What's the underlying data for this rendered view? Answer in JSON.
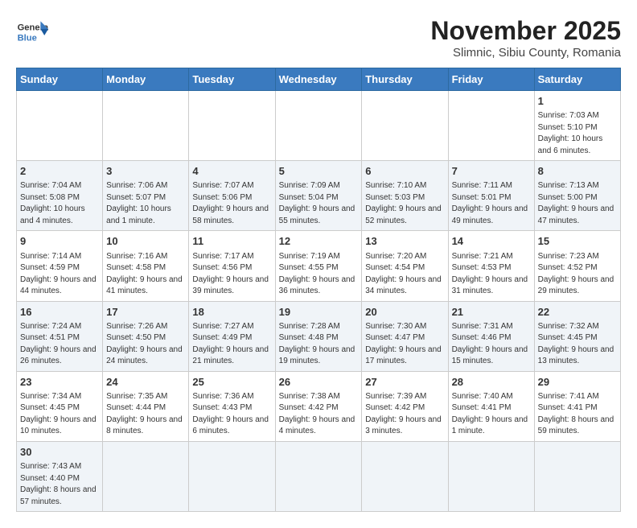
{
  "header": {
    "logo_text_line1": "General",
    "logo_text_line2": "Blue",
    "month_year": "November 2025",
    "location": "Slimnic, Sibiu County, Romania"
  },
  "days_of_week": [
    "Sunday",
    "Monday",
    "Tuesday",
    "Wednesday",
    "Thursday",
    "Friday",
    "Saturday"
  ],
  "weeks": [
    [
      {
        "day": "",
        "info": ""
      },
      {
        "day": "",
        "info": ""
      },
      {
        "day": "",
        "info": ""
      },
      {
        "day": "",
        "info": ""
      },
      {
        "day": "",
        "info": ""
      },
      {
        "day": "",
        "info": ""
      },
      {
        "day": "1",
        "info": "Sunrise: 7:03 AM\nSunset: 5:10 PM\nDaylight: 10 hours\nand 6 minutes."
      }
    ],
    [
      {
        "day": "2",
        "info": "Sunrise: 7:04 AM\nSunset: 5:08 PM\nDaylight: 10 hours\nand 4 minutes."
      },
      {
        "day": "3",
        "info": "Sunrise: 7:06 AM\nSunset: 5:07 PM\nDaylight: 10 hours\nand 1 minute."
      },
      {
        "day": "4",
        "info": "Sunrise: 7:07 AM\nSunset: 5:06 PM\nDaylight: 9 hours\nand 58 minutes."
      },
      {
        "day": "5",
        "info": "Sunrise: 7:09 AM\nSunset: 5:04 PM\nDaylight: 9 hours\nand 55 minutes."
      },
      {
        "day": "6",
        "info": "Sunrise: 7:10 AM\nSunset: 5:03 PM\nDaylight: 9 hours\nand 52 minutes."
      },
      {
        "day": "7",
        "info": "Sunrise: 7:11 AM\nSunset: 5:01 PM\nDaylight: 9 hours\nand 49 minutes."
      },
      {
        "day": "8",
        "info": "Sunrise: 7:13 AM\nSunset: 5:00 PM\nDaylight: 9 hours\nand 47 minutes."
      }
    ],
    [
      {
        "day": "9",
        "info": "Sunrise: 7:14 AM\nSunset: 4:59 PM\nDaylight: 9 hours\nand 44 minutes."
      },
      {
        "day": "10",
        "info": "Sunrise: 7:16 AM\nSunset: 4:58 PM\nDaylight: 9 hours\nand 41 minutes."
      },
      {
        "day": "11",
        "info": "Sunrise: 7:17 AM\nSunset: 4:56 PM\nDaylight: 9 hours\nand 39 minutes."
      },
      {
        "day": "12",
        "info": "Sunrise: 7:19 AM\nSunset: 4:55 PM\nDaylight: 9 hours\nand 36 minutes."
      },
      {
        "day": "13",
        "info": "Sunrise: 7:20 AM\nSunset: 4:54 PM\nDaylight: 9 hours\nand 34 minutes."
      },
      {
        "day": "14",
        "info": "Sunrise: 7:21 AM\nSunset: 4:53 PM\nDaylight: 9 hours\nand 31 minutes."
      },
      {
        "day": "15",
        "info": "Sunrise: 7:23 AM\nSunset: 4:52 PM\nDaylight: 9 hours\nand 29 minutes."
      }
    ],
    [
      {
        "day": "16",
        "info": "Sunrise: 7:24 AM\nSunset: 4:51 PM\nDaylight: 9 hours\nand 26 minutes."
      },
      {
        "day": "17",
        "info": "Sunrise: 7:26 AM\nSunset: 4:50 PM\nDaylight: 9 hours\nand 24 minutes."
      },
      {
        "day": "18",
        "info": "Sunrise: 7:27 AM\nSunset: 4:49 PM\nDaylight: 9 hours\nand 21 minutes."
      },
      {
        "day": "19",
        "info": "Sunrise: 7:28 AM\nSunset: 4:48 PM\nDaylight: 9 hours\nand 19 minutes."
      },
      {
        "day": "20",
        "info": "Sunrise: 7:30 AM\nSunset: 4:47 PM\nDaylight: 9 hours\nand 17 minutes."
      },
      {
        "day": "21",
        "info": "Sunrise: 7:31 AM\nSunset: 4:46 PM\nDaylight: 9 hours\nand 15 minutes."
      },
      {
        "day": "22",
        "info": "Sunrise: 7:32 AM\nSunset: 4:45 PM\nDaylight: 9 hours\nand 13 minutes."
      }
    ],
    [
      {
        "day": "23",
        "info": "Sunrise: 7:34 AM\nSunset: 4:45 PM\nDaylight: 9 hours\nand 10 minutes."
      },
      {
        "day": "24",
        "info": "Sunrise: 7:35 AM\nSunset: 4:44 PM\nDaylight: 9 hours\nand 8 minutes."
      },
      {
        "day": "25",
        "info": "Sunrise: 7:36 AM\nSunset: 4:43 PM\nDaylight: 9 hours\nand 6 minutes."
      },
      {
        "day": "26",
        "info": "Sunrise: 7:38 AM\nSunset: 4:42 PM\nDaylight: 9 hours\nand 4 minutes."
      },
      {
        "day": "27",
        "info": "Sunrise: 7:39 AM\nSunset: 4:42 PM\nDaylight: 9 hours\nand 3 minutes."
      },
      {
        "day": "28",
        "info": "Sunrise: 7:40 AM\nSunset: 4:41 PM\nDaylight: 9 hours\nand 1 minute."
      },
      {
        "day": "29",
        "info": "Sunrise: 7:41 AM\nSunset: 4:41 PM\nDaylight: 8 hours\nand 59 minutes."
      }
    ],
    [
      {
        "day": "30",
        "info": "Sunrise: 7:43 AM\nSunset: 4:40 PM\nDaylight: 8 hours\nand 57 minutes."
      },
      {
        "day": "",
        "info": ""
      },
      {
        "day": "",
        "info": ""
      },
      {
        "day": "",
        "info": ""
      },
      {
        "day": "",
        "info": ""
      },
      {
        "day": "",
        "info": ""
      },
      {
        "day": "",
        "info": ""
      }
    ]
  ]
}
